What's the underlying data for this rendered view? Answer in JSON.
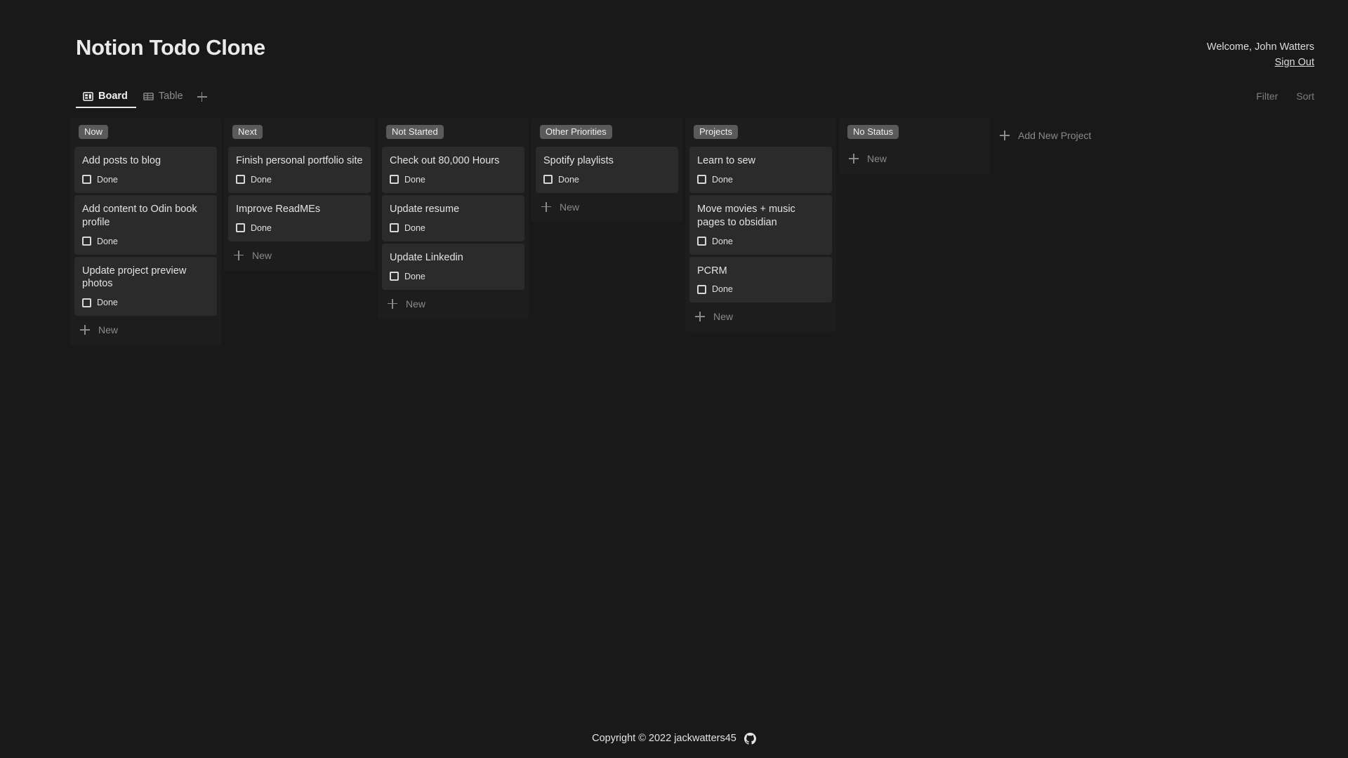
{
  "header": {
    "app_title": "Notion Todo Clone",
    "welcome_text": "Welcome, John Watters",
    "signout_label": "Sign Out"
  },
  "tabs": {
    "items": [
      {
        "label": "Board",
        "icon": "board-icon",
        "active": true
      },
      {
        "label": "Table",
        "icon": "table-icon",
        "active": false
      }
    ],
    "add_tab_label": "+"
  },
  "toolbar": {
    "filter_label": "Filter",
    "sort_label": "Sort"
  },
  "board": {
    "new_label": "New",
    "done_label": "Done",
    "add_project_label": "Add New Project",
    "columns": [
      {
        "title": "Now",
        "cards": [
          {
            "title": "Add posts to blog",
            "done": false
          },
          {
            "title": "Add content to Odin book profile",
            "done": false
          },
          {
            "title": "Update project preview photos",
            "done": false
          }
        ]
      },
      {
        "title": "Next",
        "cards": [
          {
            "title": "Finish personal portfolio site",
            "done": false
          },
          {
            "title": "Improve ReadMEs",
            "done": false
          }
        ]
      },
      {
        "title": "Not Started",
        "cards": [
          {
            "title": "Check out 80,000 Hours",
            "done": false
          },
          {
            "title": "Update resume",
            "done": false
          },
          {
            "title": "Update Linkedin",
            "done": false
          }
        ]
      },
      {
        "title": "Other Priorities",
        "cards": [
          {
            "title": "Spotify playlists",
            "done": false
          }
        ]
      },
      {
        "title": "Projects",
        "cards": [
          {
            "title": "Learn to sew",
            "done": false
          },
          {
            "title": "Move movies + music pages to obsidian",
            "done": false
          },
          {
            "title": "PCRM",
            "done": false
          }
        ]
      },
      {
        "title": "No Status",
        "cards": []
      }
    ]
  },
  "footer": {
    "copyright": "Copyright © 2022 jackwatters45",
    "icon": "github-icon"
  },
  "colors": {
    "page_bg": "#191919",
    "column_bg": "#1d1d1d",
    "card_bg": "#2b2b2b",
    "badge_bg": "#5a5a5a",
    "text_primary": "#e6e6e6",
    "text_muted": "#8a8a8a"
  }
}
